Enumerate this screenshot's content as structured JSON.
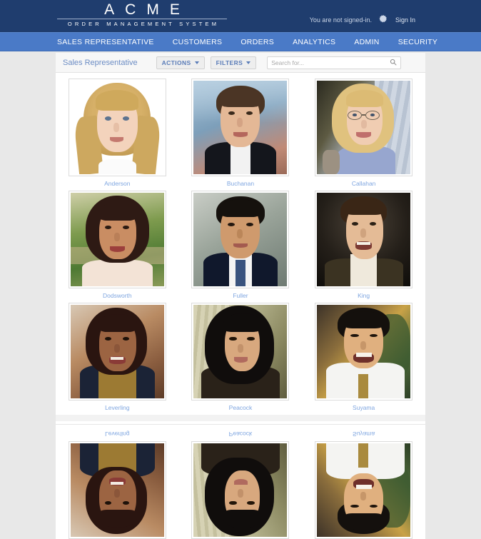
{
  "header": {
    "logo_main": "ACME",
    "logo_sub": "ORDER MANAGEMENT SYSTEM",
    "signed_in_status": "You are not signed-in.",
    "sign_in_label": "Sign In",
    "gear_icon": "gear-icon",
    "bg_color": "#1f3d6e"
  },
  "nav": {
    "bg_color": "#4a7ac7",
    "items": [
      {
        "label": "SALES REPRESENTATIVE"
      },
      {
        "label": "CUSTOMERS"
      },
      {
        "label": "ORDERS"
      },
      {
        "label": "ANALYTICS"
      },
      {
        "label": "ADMIN"
      },
      {
        "label": "SECURITY"
      }
    ]
  },
  "toolbar": {
    "title": "Sales Representative",
    "actions_label": "ACTIONS",
    "filters_label": "FILTERS",
    "search_placeholder": "Search for...",
    "search_value": "",
    "search_icon": "search-icon",
    "title_color": "#6b8cc4"
  },
  "grid": {
    "cards": [
      {
        "name": "Anderson",
        "portrait": "anderson"
      },
      {
        "name": "Buchanan",
        "portrait": "buchanan"
      },
      {
        "name": "Callahan",
        "portrait": "callahan"
      },
      {
        "name": "Dodsworth",
        "portrait": "dodsworth"
      },
      {
        "name": "Fuller",
        "portrait": "fuller"
      },
      {
        "name": "King",
        "portrait": "king"
      },
      {
        "name": "Leverling",
        "portrait": "leverling"
      },
      {
        "name": "Peacock",
        "portrait": "peacock"
      },
      {
        "name": "Suyama",
        "portrait": "suyama"
      }
    ],
    "label_color": "#7fa6e0"
  },
  "reflection": {
    "cards": [
      {
        "name": "Leverling",
        "portrait": "leverling"
      },
      {
        "name": "Peacock",
        "portrait": "peacock"
      },
      {
        "name": "Suyama",
        "portrait": "suyama"
      }
    ]
  }
}
